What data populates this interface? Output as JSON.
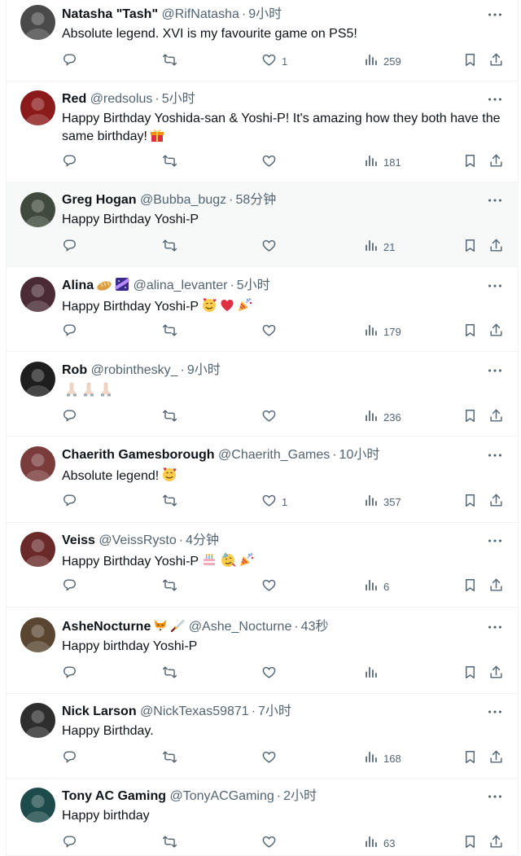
{
  "tweets": [
    {
      "name": "Natasha \"Tash\"",
      "handle": "@RifNatasha",
      "time": "9小时",
      "text": "Absolute legend. XVI is my favourite game on PS5!",
      "likes": "1",
      "views": "259",
      "avatar_color": "#4a4a4a",
      "highlight": false
    },
    {
      "name": "Red",
      "handle": "@redsolus",
      "time": "5小时",
      "text": "Happy Birthday Yoshida-san & Yoshi-P! It's amazing how they both have the same birthday!",
      "emojis": [
        "wrapped-gift"
      ],
      "likes": "",
      "views": "181",
      "avatar_color": "#8b1a1a",
      "highlight": false
    },
    {
      "name": "Greg Hogan",
      "handle": "@Bubba_bugz",
      "time": "58分钟",
      "text": "Happy Birthday Yoshi-P",
      "likes": "",
      "views": "21",
      "avatar_color": "#3f4a3c",
      "highlight": true
    },
    {
      "name": "Alina",
      "name_emojis": [
        "bread",
        "milky-way"
      ],
      "handle": "@alina_levanter",
      "time": "5小时",
      "text": "Happy Birthday Yoshi-P",
      "emojis": [
        "smiling-face-with-hearts",
        "red-heart",
        "party-popper"
      ],
      "likes": "",
      "views": "179",
      "avatar_color": "#4a2a35",
      "highlight": false
    },
    {
      "name": "Rob",
      "handle": "@robinthesky_",
      "time": "9小时",
      "text": "",
      "emojis": [
        "folded-hands",
        "folded-hands",
        "folded-hands"
      ],
      "likes": "",
      "views": "236",
      "avatar_color": "#1e1e1e",
      "highlight": false
    },
    {
      "name": "Chaerith Gamesborough",
      "handle": "@Chaerith_Games",
      "time": "10小时",
      "text": "Absolute legend!",
      "emojis": [
        "smiling-face-with-hearts"
      ],
      "likes": "1",
      "views": "357",
      "avatar_color": "#7a3b3b",
      "highlight": false
    },
    {
      "name": "Veiss",
      "handle": "@VeissRysto",
      "time": "4分钟",
      "text": "Happy Birthday Yoshi-P",
      "emojis": [
        "birthday-cake",
        "partying-face",
        "party-popper"
      ],
      "likes": "",
      "views": "6",
      "avatar_color": "#6b2a2a",
      "highlight": false
    },
    {
      "name": "AsheNocturne",
      "name_emojis": [
        "fox-face",
        "dagger"
      ],
      "handle": "@Ashe_Nocturne",
      "time": "43秒",
      "text": "Happy birthday Yoshi-P",
      "likes": "",
      "views": "",
      "avatar_color": "#5a4630",
      "highlight": false
    },
    {
      "name": "Nick Larson",
      "handle": "@NickTexas59871",
      "time": "7小时",
      "text": "Happy Birthday.",
      "likes": "",
      "views": "168",
      "avatar_color": "#2e2e2e",
      "highlight": false
    },
    {
      "name": "Tony AC Gaming",
      "handle": "@TonyACGaming",
      "time": "2小时",
      "text": "Happy birthday",
      "likes": "",
      "views": "63",
      "avatar_color": "#1d4a4a",
      "highlight": false
    }
  ],
  "colors": {
    "text_primary": "#0f1419",
    "text_secondary": "#536471",
    "divider": "#eff3f4",
    "highlight_bg": "#f7f9f9"
  }
}
